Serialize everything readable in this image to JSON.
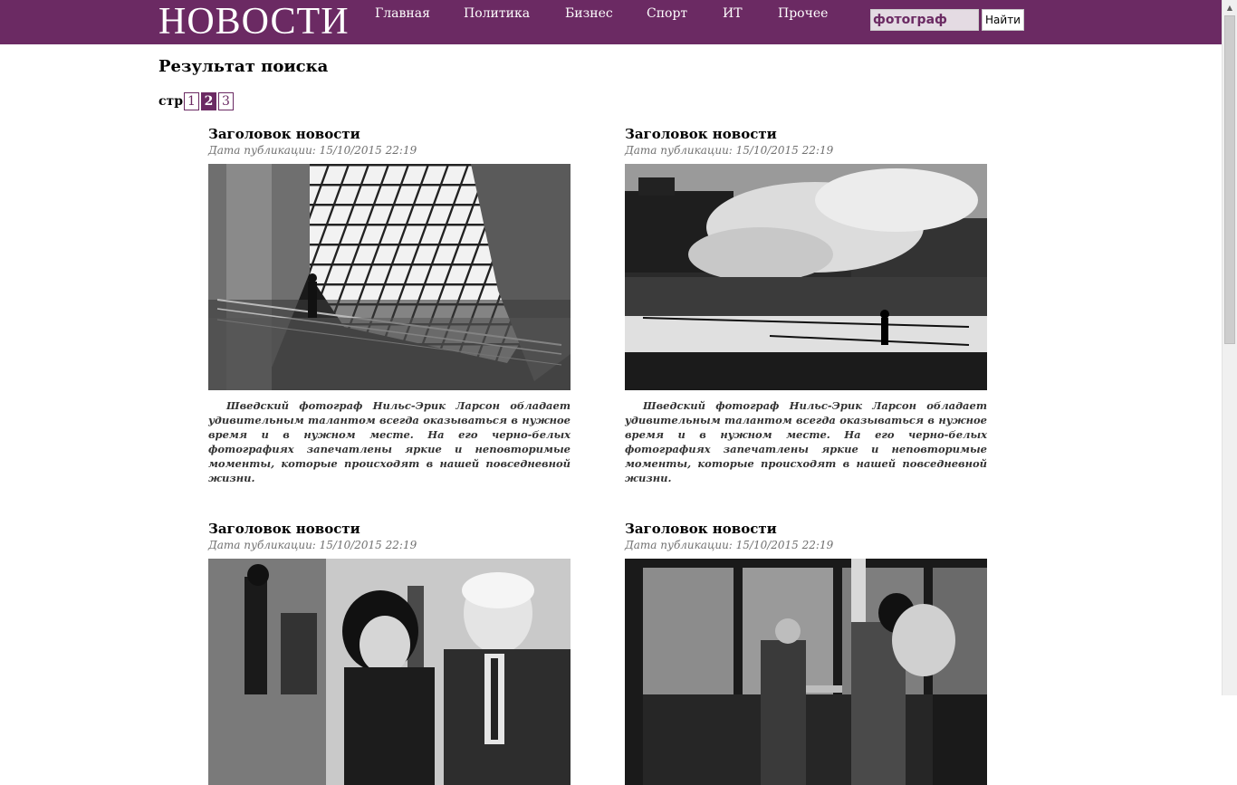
{
  "header": {
    "logo": "НОВОСТИ",
    "nav": [
      "Главная",
      "Политика",
      "Бизнес",
      "Спорт",
      "ИТ",
      "Прочее"
    ],
    "search": {
      "value": "фотограф",
      "button": "Найти"
    },
    "accent_color": "#6b2a63"
  },
  "main": {
    "title": "Результат поиска",
    "pager": {
      "label": "стр.",
      "pages": [
        "1",
        "2",
        "3"
      ],
      "current": "2"
    },
    "articles": [
      {
        "title": "Заголовок новости",
        "date": "Дата публикации: 15/10/2015 22:19",
        "image": "architecture-photo",
        "text": "Шведский фотограф Нильс-Эрик Ларсон обладает удивительным талантом всегда оказываться в нужное время и в нужном месте. На его черно-белых фотографиях запечатлены яркие и неповторимые моменты, которые происходят в нашей повседневной жизни."
      },
      {
        "title": "Заголовок новости",
        "date": "Дата публикации: 15/10/2015 22:19",
        "image": "city-steam-photo",
        "text": "Шведский фотограф Нильс-Эрик Ларсон обладает удивительным талантом всегда оказываться в нужное время и в нужном месте. На его черно-белых фотографиях запечатлены яркие и неповторимые моменты, которые происходят в нашей повседневной жизни."
      },
      {
        "title": "Заголовок новости",
        "date": "Дата публикации: 15/10/2015 22:19",
        "image": "elderly-couple-photo"
      },
      {
        "title": "Заголовок новости",
        "date": "Дата публикации: 15/10/2015 22:19",
        "image": "street-scene-photo"
      }
    ]
  }
}
